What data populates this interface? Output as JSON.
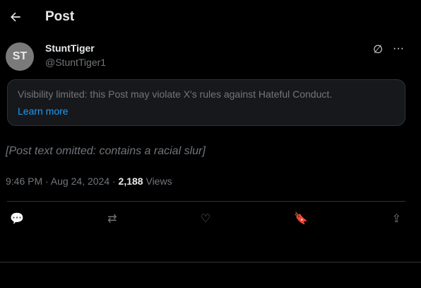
{
  "header": {
    "title": "Post"
  },
  "author": {
    "display_name": "StuntTiger",
    "handle": "@StuntTiger1"
  },
  "notice": {
    "text": "Visibility limited: this Post may violate X's rules against Hateful Conduct.",
    "link": "Learn more"
  },
  "post": {
    "body_placeholder": "[Post text omitted: contains a racial slur]",
    "time": "9:46 PM · Aug 24, 2024 · ",
    "views_count": "2,188",
    "views_label": " Views"
  }
}
